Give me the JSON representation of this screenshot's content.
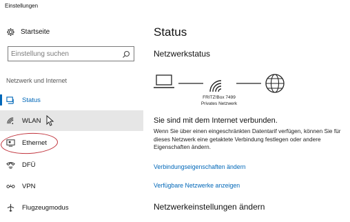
{
  "window": {
    "title": "Einstellungen"
  },
  "sidebar": {
    "home": {
      "label": "Startseite",
      "icon": "gear-icon"
    },
    "search": {
      "placeholder": "Einstellung suchen",
      "value": "",
      "icon": "search-icon"
    },
    "group_label": "Netzwerk und Internet",
    "items": [
      {
        "label": "Status",
        "icon": "status-icon",
        "active": true
      },
      {
        "label": "WLAN",
        "icon": "wifi-icon",
        "hover": true
      },
      {
        "label": "Ethernet",
        "icon": "ethernet-icon"
      },
      {
        "label": "DFÜ",
        "icon": "dialup-icon"
      },
      {
        "label": "VPN",
        "icon": "vpn-icon"
      },
      {
        "label": "Flugzeugmodus",
        "icon": "airplane-icon"
      }
    ]
  },
  "main": {
    "title": "Status",
    "network_status_heading": "Netzwerkstatus",
    "router": {
      "name": "FRITZ!Box 7499",
      "network_type": "Privates Netzwerk"
    },
    "connection_title": "Sie sind mit dem Internet verbunden.",
    "connection_desc": "Wenn Sie über einen eingeschränkten Datentarif verfügen, können Sie für dieses Netzwerk eine getaktete Verbindung festlegen oder andere Eigenschaften ändern.",
    "links": {
      "properties": "Verbindungseigenschaften ändern",
      "available": "Verfügbare Netzwerke anzeigen"
    },
    "settings_heading": "Netzwerkeinstellungen ändern"
  },
  "colors": {
    "accent": "#0067b8",
    "hover_bg": "#e6e6e6",
    "annotation": "#c0313a"
  }
}
